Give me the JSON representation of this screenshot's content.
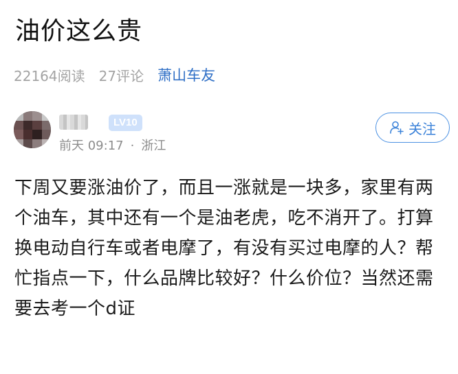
{
  "post": {
    "title": "油价这么贵",
    "views": "22164阅读",
    "comments": "27评论",
    "forum": "萧山车友",
    "body": "下周又要涨油价了，而且一涨就是一块多，家里有两个油车，其中还有一个是油老虎，吃不消开了。打算换电动自行车或者电摩了，有没有买过电摩的人？帮忙指点一下，什么品牌比较好？什么价位？当然还需要去考一个d证"
  },
  "author": {
    "level": "LV10",
    "time": "前天 09:17",
    "separator": "·",
    "location": "浙江",
    "follow_label": "关注"
  },
  "colors": {
    "accent": "#3b82d9",
    "meta_gray": "#a3a3a3",
    "badge_bg": "#cfe1fb"
  },
  "icons": {
    "follow": "add-user-icon"
  }
}
